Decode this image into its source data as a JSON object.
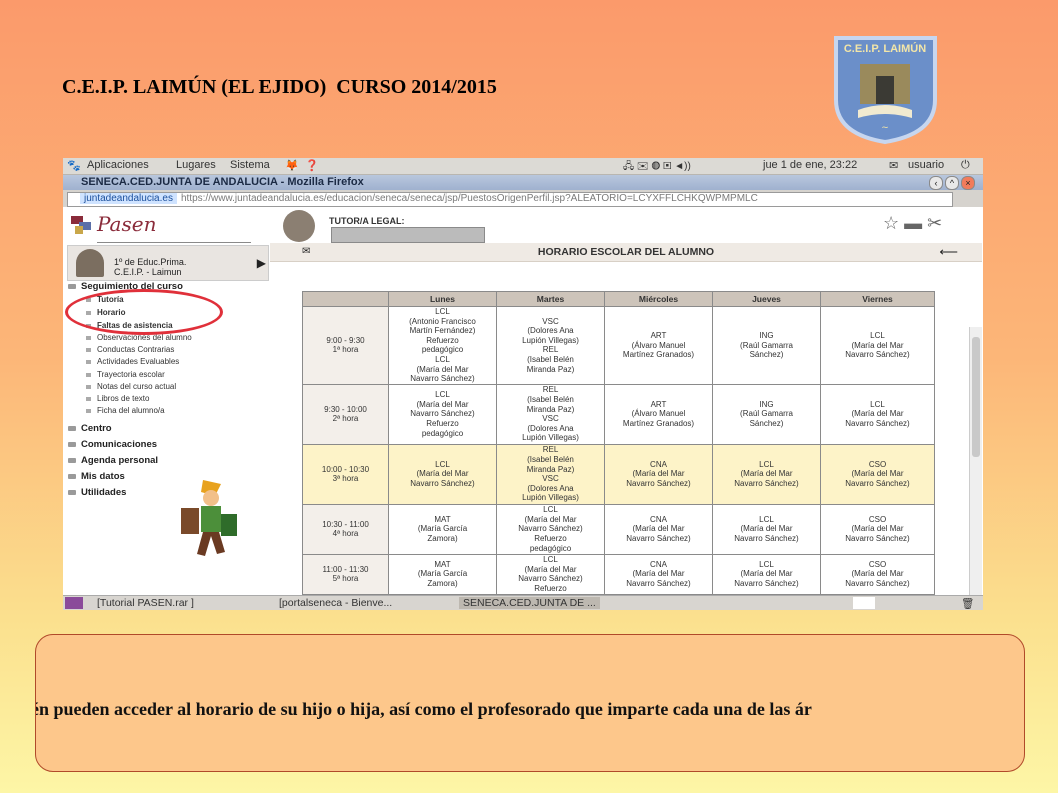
{
  "slide": {
    "title": "C.E.I.P. LAIMÚN (EL EJIDO)  CURSO 2014/2015",
    "logo_text": "C.E.I.P. LAIMÚN",
    "caption": "mbién pueden acceder al horario de su hijo o hija, así como el profesorado que imparte cada una de las ár"
  },
  "desktop": {
    "menu": [
      "Aplicaciones",
      "Lugares",
      "Sistema"
    ],
    "clock": "jue  1 de ene, 23:22",
    "user": "usuario"
  },
  "browser": {
    "window_title": "SENECA.CED.JUNTA DE ANDALUCIA - Mozilla Firefox",
    "url_host": "juntadeandalucia.es",
    "url_path": "https://www.juntadeandalucia.es/educacion/seneca/seneca/jsp/PuestosOrigenPerfil.jsp?ALEATORIO=LCYXFFLCHKQWPMPMLC"
  },
  "app": {
    "brand": "Pasen",
    "tutor_label": "TUTOR/A LEGAL:",
    "student": {
      "course": "1º de Educ.Prima.",
      "school": "C.E.I.P. - Laimun"
    },
    "sections": [
      {
        "label": "Seguimiento del curso",
        "items": [
          "Tutoría",
          "Horario",
          "Faltas de asistencia",
          "Observaciones del alumno",
          "Conductas Contrarias",
          "Actividades Evaluables",
          "Trayectoria escolar",
          "Notas del curso actual",
          "Libros de texto",
          "Ficha del alumno/a"
        ]
      },
      {
        "label": "Centro"
      },
      {
        "label": "Comunicaciones"
      },
      {
        "label": "Agenda personal"
      },
      {
        "label": "Mis datos"
      },
      {
        "label": "Utilidades"
      }
    ],
    "page_title": "HORARIO ESCOLAR DEL ALUMNO"
  },
  "schedule": {
    "days": [
      "Lunes",
      "Martes",
      "Miércoles",
      "Jueves",
      "Viernes"
    ],
    "rows": [
      {
        "time": "9:00 - 9:30\n1ª hora",
        "cells": [
          "LCL\n(Antonio Francisco\nMartín Fernández)\nRefuerzo\npedagógico\nLCL\n(María del Mar\nNavarro Sánchez)",
          "VSC\n(Dolores Ana\nLupión Villegas)\nREL\n(Isabel Belén\nMiranda Paz)",
          "ART\n(Álvaro Manuel\nMartínez Granados)",
          "ING\n(Raúl Gamarra\nSánchez)",
          "LCL\n(María del Mar\nNavarro Sánchez)"
        ]
      },
      {
        "time": "9:30 - 10:00\n2ª hora",
        "cells": [
          "LCL\n(María del Mar\nNavarro Sánchez)\nRefuerzo\npedagógico",
          "REL\n(Isabel Belén\nMiranda Paz)\nVSC\n(Dolores Ana\nLupión Villegas)",
          "ART\n(Álvaro Manuel\nMartínez Granados)",
          "ING\n(Raúl Gamarra\nSánchez)",
          "LCL\n(María del Mar\nNavarro Sánchez)"
        ]
      },
      {
        "time": "10:00 - 10:30\n3ª hora",
        "highlight": true,
        "cells": [
          "LCL\n(María del Mar\nNavarro Sánchez)",
          "REL\n(Isabel Belén\nMiranda Paz)\nVSC\n(Dolores Ana\nLupión Villegas)",
          "CNA\n(María del Mar\nNavarro Sánchez)",
          "LCL\n(María del Mar\nNavarro Sánchez)",
          "CSO\n(María del Mar\nNavarro Sánchez)"
        ]
      },
      {
        "time": "10:30 - 11:00\n4ª hora",
        "cells": [
          "MAT\n(María García\nZamora)",
          "LCL\n(María del Mar\nNavarro Sánchez)\nRefuerzo\npedagógico",
          "CNA\n(María del Mar\nNavarro Sánchez)",
          "LCL\n(María del Mar\nNavarro Sánchez)",
          "CSO\n(María del Mar\nNavarro Sánchez)"
        ]
      },
      {
        "time": "11:00 - 11:30\n5ª hora",
        "cells": [
          "MAT\n(María García\nZamora)",
          "LCL\n(María del Mar\nNavarro Sánchez)\nRefuerzo",
          "CNA\n(María del Mar\nNavarro Sánchez)",
          "LCL\n(María del Mar\nNavarro Sánchez)",
          "CSO\n(María del Mar\nNavarro Sánchez)"
        ]
      }
    ]
  },
  "taskbar": [
    "[Tutorial PASEN.rar ]",
    "[portalseneca - Bienve...",
    "SENECA.CED.JUNTA DE ..."
  ]
}
